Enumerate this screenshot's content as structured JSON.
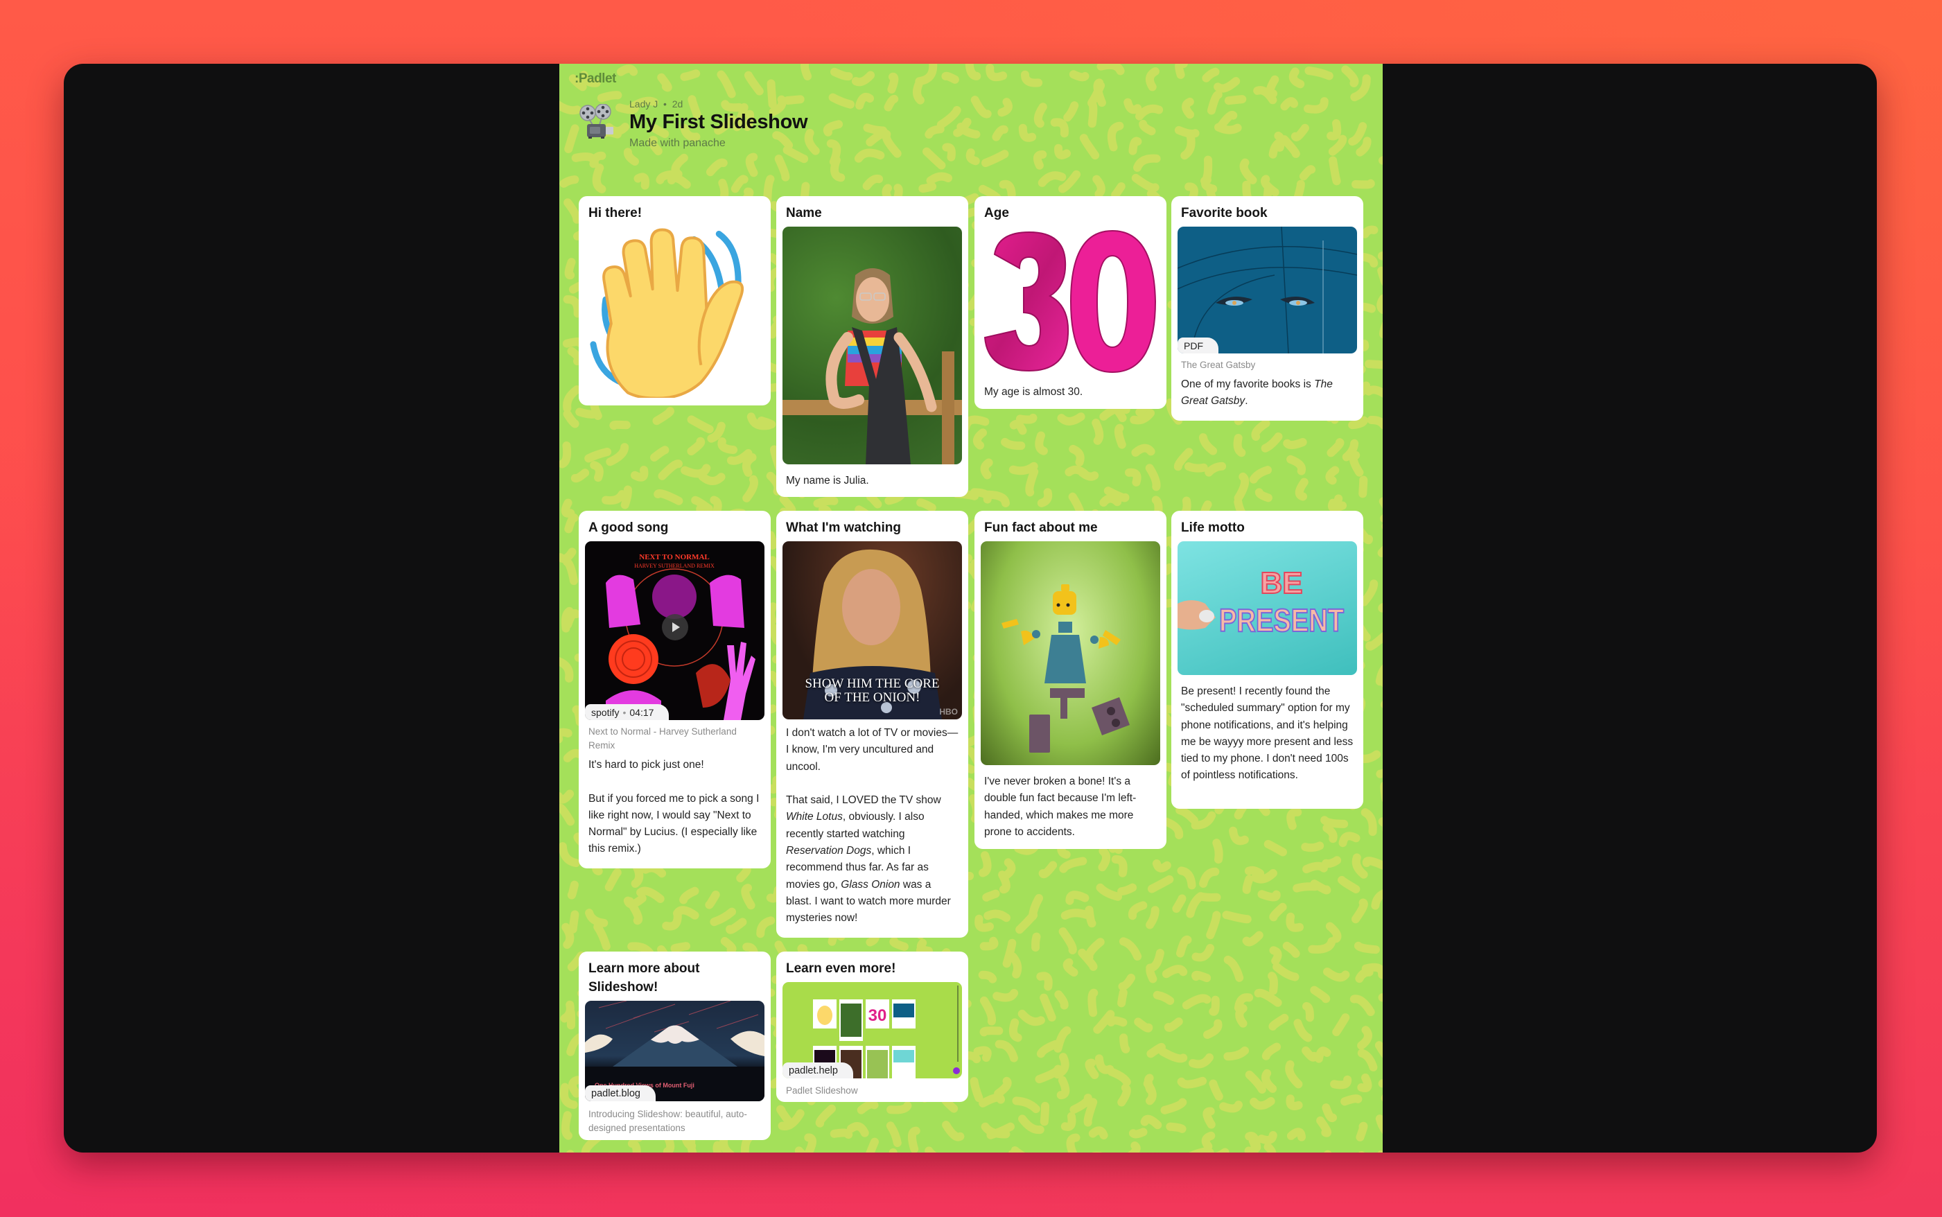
{
  "padlet": {
    "logo": ":Padlet",
    "author": "Lady J",
    "age": "2d",
    "title": "My First Slideshow",
    "subtitle": "Made with panache",
    "icon": "film-projector-icon"
  },
  "colors": {
    "background_green": "#a4e05a",
    "pattern_yellow": "#c9df5e",
    "frame": "#0f0f10",
    "card": "#ffffff"
  },
  "cards": [
    {
      "title": "Hi there!",
      "media": "waving-hand-emoji",
      "text": ""
    },
    {
      "title": "Name",
      "media": "photo-of-julia",
      "text": "My name is Julia."
    },
    {
      "title": "Age",
      "media": "number-30-balloons",
      "text": "My age is almost 30."
    },
    {
      "title": "Favorite book",
      "media": "great-gatsby-cover",
      "badge": "PDF",
      "attachment_title": "The Great Gatsby",
      "text_parts": [
        "One of my favorite books is ",
        "The Great Gatsby",
        "."
      ]
    },
    {
      "title": "A good song",
      "media": "next-to-normal-album-art",
      "badge_source": "spotify",
      "badge_duration": "04:17",
      "attachment_title": "Next to Normal - Harvey Sutherland Remix",
      "text": "It's hard to pick just one!\n\nBut if you forced me to pick a song I like right now, I would say \"Next to Normal\" by Lucius. (I especially like this remix.)"
    },
    {
      "title": "What I'm watching",
      "media": "white-lotus-gif",
      "media_caption": "SHOW HIM THE CORE OF THE ONION!",
      "media_watermark": "HBO",
      "text_parts": [
        "I don't watch a lot of TV or movies—I know, I'm very uncultured and uncool.\n\nThat said, I LOVED the TV show ",
        "White Lotus",
        ", obviously. I also recently started watching ",
        "Reservation Dogs",
        ", which I recommend thus far. As far as movies go, ",
        "Glass Onion",
        " was a blast. I want to watch more murder mysteries now!"
      ]
    },
    {
      "title": "Fun fact about me",
      "media": "broken-lego-figure",
      "text": "I've never broken a bone! It's a double fun fact because I'm left-handed, which makes me more prone to accidents."
    },
    {
      "title": "Life motto",
      "media": "be-present-sticker",
      "media_caption": "BE PRESENT",
      "text": "Be present! I recently found the \"scheduled summary\" option for my phone notifications, and it's helping me be wayyy more present and less tied to my phone. I don't need 100s of pointless notifications."
    },
    {
      "title": "Learn more about Slideshow!",
      "media": "mount-fuji-illustration",
      "badge": "padlet.blog",
      "media_caption": "One Hundred Views of Mount Fuji",
      "attachment_title": "Introducing Slideshow: beautiful, auto-designed presentations"
    },
    {
      "title": "Learn even more!",
      "media": "padlet-slideshow-screenshot",
      "badge": "padlet.help",
      "attachment_title": "Padlet Slideshow"
    }
  ]
}
